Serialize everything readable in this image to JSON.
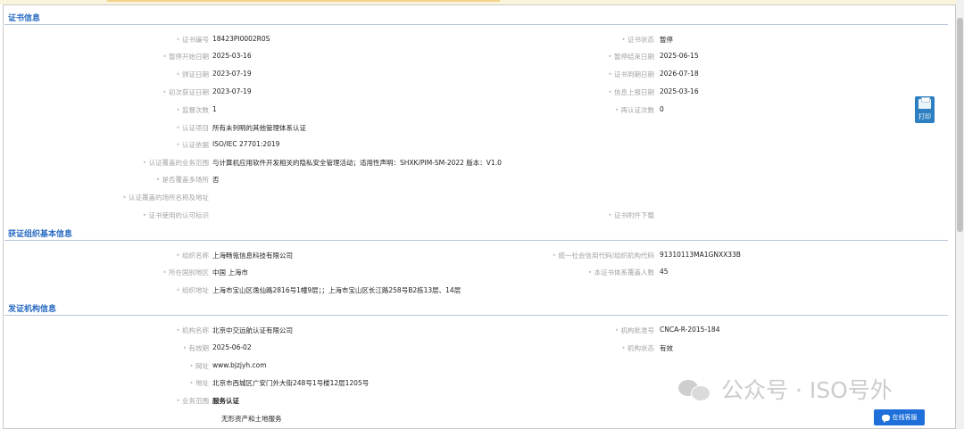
{
  "sections": {
    "certificate": {
      "title": "证书信息",
      "cert_no": {
        "label": "证书编号",
        "value": "18423PI0002R0S"
      },
      "cert_status": {
        "label": "证书状态",
        "value": "暂停"
      },
      "suspend_start": {
        "label": "暂停开始日期",
        "value": "2025-03-16"
      },
      "suspend_end": {
        "label": "暂停结束日期",
        "value": "2025-06-15"
      },
      "issue_date": {
        "label": "颁证日期",
        "value": "2023-07-19"
      },
      "expiry_date": {
        "label": "证书到期日期",
        "value": "2026-07-18"
      },
      "first_date": {
        "label": "初次获证日期",
        "value": "2023-07-19"
      },
      "report_date": {
        "label": "信息上报日期",
        "value": "2025-03-16"
      },
      "surveillance_count": {
        "label": "监督次数",
        "value": "1"
      },
      "recert_count": {
        "label": "再认证次数",
        "value": "0"
      },
      "cert_project": {
        "label": "认证项目",
        "value": "所有未列明的其他管理体系认证"
      },
      "cert_basis": {
        "label": "认证依据",
        "value": "ISO/IEC 27701:2019"
      },
      "scope": {
        "label": "认证覆盖的业务范围",
        "value": "与计算机应用软件开发相关的隐私安全管理活动；适用性声明：SHXK/PIM-SM-2022 版本：V1.0"
      },
      "multi_site": {
        "label": "是否覆盖多场所",
        "value": "否"
      },
      "site_names": {
        "label": "认证覆盖的场所名称及地址",
        "value": ""
      },
      "accreditation_mark": {
        "label": "证书使用的认可标识",
        "value": ""
      },
      "attachment": {
        "label": "证书附件下载",
        "value": ""
      }
    },
    "organization": {
      "title": "获证组织基本信息",
      "org_name": {
        "label": "组织名称",
        "value": "上海畅瓴信息科技有限公司"
      },
      "credit_code": {
        "label": "统一社会信用代码/组织机构代码",
        "value": "91310113MA1GNXX33B"
      },
      "region": {
        "label": "所在国别地区",
        "value": "中国 上海市"
      },
      "headcount": {
        "label": "本证书体系覆盖人数",
        "value": "45"
      },
      "address": {
        "label": "组织地址",
        "value": "上海市宝山区逸仙路2816号1幢9层；；上海市宝山区长江路258号B2栋13层、14层"
      }
    },
    "issuer": {
      "title": "发证机构信息",
      "issuer_name": {
        "label": "机构名称",
        "value": "北京中交远航认证有限公司"
      },
      "approval_no": {
        "label": "机构批准号",
        "value": "CNCA-R-2015-184"
      },
      "valid_until": {
        "label": "有效期",
        "value": "2025-06-02"
      },
      "issuer_status": {
        "label": "机构状态",
        "value": "有效"
      },
      "website": {
        "label": "网址",
        "value": "www.bjzjyh.com"
      },
      "issuer_address": {
        "label": "地址",
        "value": "北京市西城区广安门外大街248号1号楼12层1205号"
      },
      "business_scope": {
        "label": "业务范围",
        "value": "服务认证"
      },
      "business_scope_item": "无形资产和土地服务"
    }
  },
  "print_button": {
    "label": "打印",
    "icon": "printer-icon"
  },
  "chat_button": {
    "label": "在线客服",
    "icon": "chat-bubble-icon"
  },
  "watermark": {
    "text": "公众号 · ISO号外",
    "icon": "wechat-icon"
  },
  "colors": {
    "section_title": "#2a6cc2",
    "print_button": "#2d7fc1",
    "chat_button": "#1e6fd9",
    "label_text": "#a3a3a3"
  }
}
